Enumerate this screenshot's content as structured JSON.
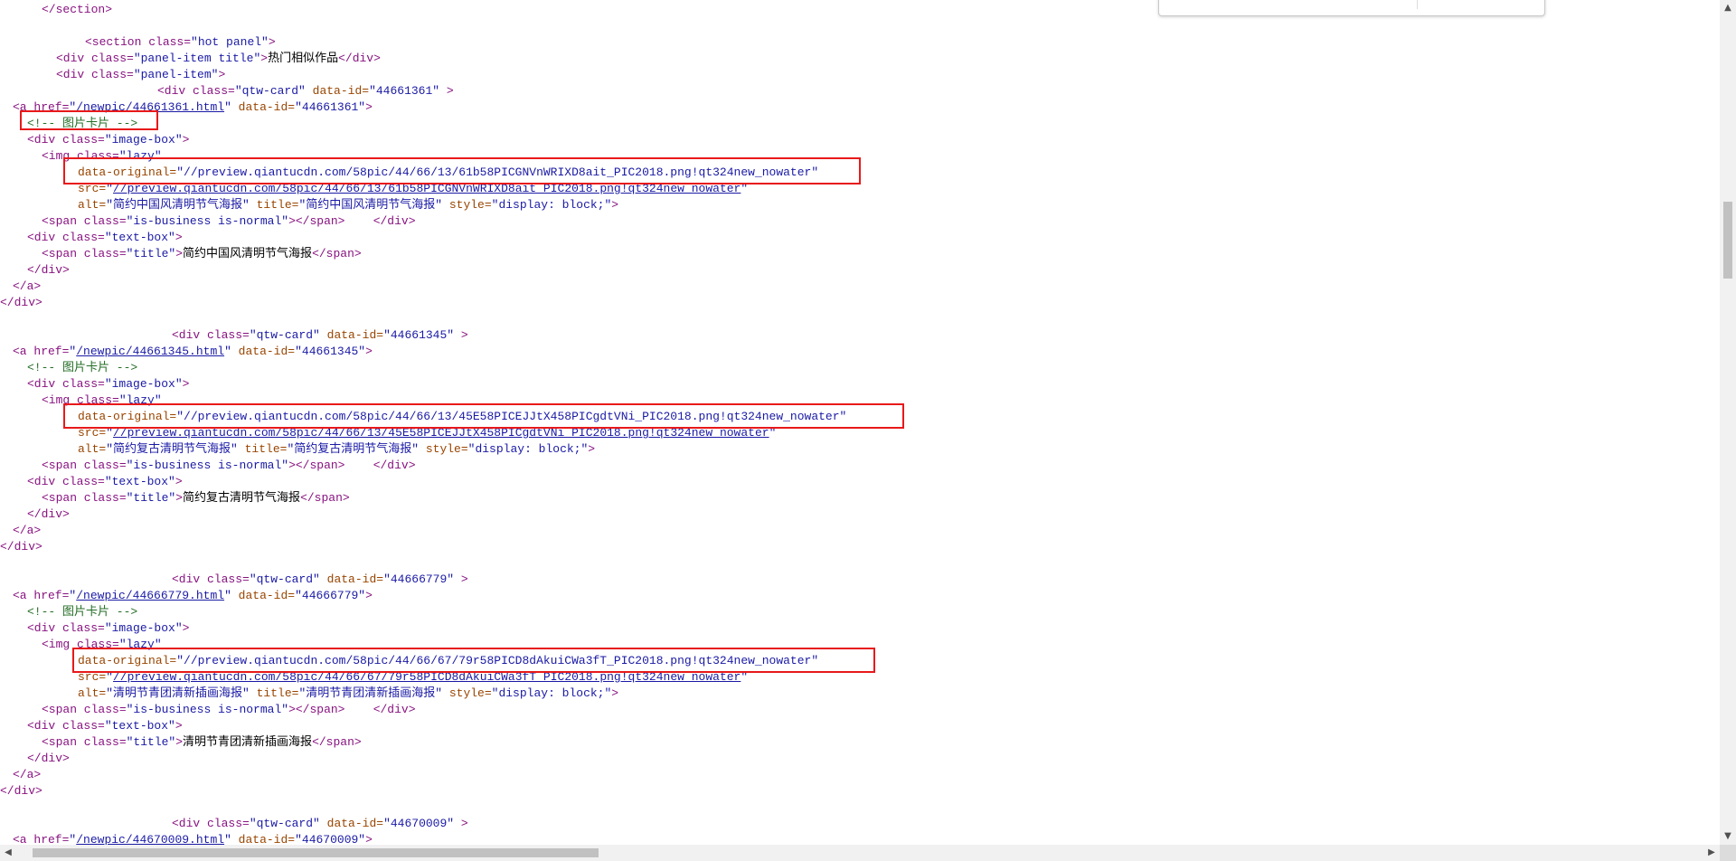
{
  "code": {
    "line01": {
      "close_section": "</section>"
    },
    "line02": {
      "a": "<section class=",
      "b": "\"hot panel\"",
      "c": ">"
    },
    "line03": {
      "a": "<div class=",
      "b": "\"panel-item title\"",
      "c": ">",
      "text": "热门相似作品",
      "d": "</div>"
    },
    "line04": {
      "a": "<div class=",
      "b": "\"panel-item\"",
      "c": ">"
    },
    "cards": [
      {
        "card_open": {
          "a": "<div class=",
          "b": "\"qtw-card\"",
          "c": " data-id=",
          "d": "\"44661361\"",
          "e": " >"
        },
        "a_open": {
          "a": "<a href=",
          "q1": "\"",
          "href": "/newpic/44661361.html",
          "q2": "\"",
          "b": " data-id=",
          "c": "\"44661361\"",
          "d": ">"
        },
        "comment": "<!-- 图片卡片 -->",
        "image_box": {
          "a": "<div class=",
          "b": "\"image-box\"",
          "c": ">"
        },
        "img_open": {
          "a": "<img class=",
          "b": "\"lazy\""
        },
        "data_original": {
          "a": "data-original=",
          "b": "\"//preview.qiantucdn.com/58pic/44/66/13/61b58PICGNVnWRIXD8ait_PIC2018.png!qt324new_nowater\""
        },
        "src": {
          "a": "src=",
          "q1": "\"",
          "url": "//preview.qiantucdn.com/58pic/44/66/13/61b58PICGNVnWRIXD8ait_PIC2018.png!qt324new_nowater",
          "q2": "\""
        },
        "alt": {
          "a": "alt=",
          "b": "\"简约中国风清明节气海报\"",
          "c": " title=",
          "d": "\"简约中国风清明节气海报\"",
          "e": " style=",
          "f": "\"display: block;\"",
          "g": ">"
        },
        "span_business": {
          "a": "<span class=",
          "b": "\"is-business is-normal\"",
          "c": "></span>",
          "d": "    </div>"
        },
        "text_box": {
          "a": "<div class=",
          "b": "\"text-box\"",
          "c": ">"
        },
        "span_title": {
          "a": "<span class=",
          "b": "\"title\"",
          "c": ">",
          "text": "简约中国风清明节气海报",
          "d": "</span>"
        },
        "close_div1": "</div>",
        "close_a": "</a>",
        "close_div2": "</div>"
      },
      {
        "card_open": {
          "a": "<div class=",
          "b": "\"qtw-card\"",
          "c": " data-id=",
          "d": "\"44661345\"",
          "e": " >"
        },
        "a_open": {
          "a": "<a href=",
          "q1": "\"",
          "href": "/newpic/44661345.html",
          "q2": "\"",
          "b": " data-id=",
          "c": "\"44661345\"",
          "d": ">"
        },
        "comment": "<!-- 图片卡片 -->",
        "image_box": {
          "a": "<div class=",
          "b": "\"image-box\"",
          "c": ">"
        },
        "img_open": {
          "a": "<img class=",
          "b": "\"lazy\""
        },
        "data_original": {
          "a": "data-original=",
          "b": "\"//preview.qiantucdn.com/58pic/44/66/13/45E58PICEJJtX458PICgdtVNi_PIC2018.png!qt324new_nowater\""
        },
        "src": {
          "a": "src=",
          "q1": "\"",
          "url": "//preview.qiantucdn.com/58pic/44/66/13/45E58PICEJJtX458PICgdtVNi_PIC2018.png!qt324new_nowater",
          "q2": "\""
        },
        "alt": {
          "a": "alt=",
          "b": "\"简约复古清明节气海报\"",
          "c": " title=",
          "d": "\"简约复古清明节气海报\"",
          "e": " style=",
          "f": "\"display: block;\"",
          "g": ">"
        },
        "span_business": {
          "a": "<span class=",
          "b": "\"is-business is-normal\"",
          "c": "></span>",
          "d": "    </div>"
        },
        "text_box": {
          "a": "<div class=",
          "b": "\"text-box\"",
          "c": ">"
        },
        "span_title": {
          "a": "<span class=",
          "b": "\"title\"",
          "c": ">",
          "text": "简约复古清明节气海报",
          "d": "</span>"
        },
        "close_div1": "</div>",
        "close_a": "</a>",
        "close_div2": "</div>"
      },
      {
        "card_open": {
          "a": "<div class=",
          "b": "\"qtw-card\"",
          "c": " data-id=",
          "d": "\"44666779\"",
          "e": " >"
        },
        "a_open": {
          "a": "<a href=",
          "q1": "\"",
          "href": "/newpic/44666779.html",
          "q2": "\"",
          "b": " data-id=",
          "c": "\"44666779\"",
          "d": ">"
        },
        "comment": "<!-- 图片卡片 -->",
        "image_box": {
          "a": "<div class=",
          "b": "\"image-box\"",
          "c": ">"
        },
        "img_open": {
          "a": "<img class=",
          "b": "\"lazy\""
        },
        "data_original": {
          "a": "data-original=",
          "b": "\"//preview.qiantucdn.com/58pic/44/66/67/79r58PICD8dAkuiCWa3fT_PIC2018.png!qt324new_nowater\""
        },
        "src": {
          "a": "src=",
          "q1": "\"",
          "url": "//preview.qiantucdn.com/58pic/44/66/67/79r58PICD8dAkuiCWa3fT_PIC2018.png!qt324new_nowater",
          "q2": "\""
        },
        "alt": {
          "a": "alt=",
          "b": "\"清明节青团清新插画海报\"",
          "c": " title=",
          "d": "\"清明节青团清新插画海报\"",
          "e": " style=",
          "f": "\"display: block;\"",
          "g": ">"
        },
        "span_business": {
          "a": "<span class=",
          "b": "\"is-business is-normal\"",
          "c": "></span>",
          "d": "    </div>"
        },
        "text_box": {
          "a": "<div class=",
          "b": "\"text-box\"",
          "c": ">"
        },
        "span_title": {
          "a": "<span class=",
          "b": "\"title\"",
          "c": ">",
          "text": "清明节青团清新插画海报",
          "d": "</span>"
        },
        "close_div1": "</div>",
        "close_a": "</a>",
        "close_div2": "</div>"
      }
    ],
    "line_last_card": {
      "a": "<div class=",
      "b": "\"qtw-card\"",
      "c": " data-id=",
      "d": "\"44670009\"",
      "e": " >"
    },
    "line_last_a": {
      "a": "<a href=",
      "q1": "\"",
      "href": "/newpic/44670009.html",
      "q2": "\"",
      "b": " data-id=",
      "c": "\"44670009\"",
      "d": ">"
    }
  },
  "colors": {
    "tag": "#881280",
    "attr_name": "#994500",
    "attr_value": "#1a1aa6",
    "comment": "#236e25",
    "highlight": "#e8191a"
  },
  "icons": {
    "scroll_up": "scroll-up-arrow-icon",
    "scroll_down": "scroll-down-arrow-icon",
    "scroll_left": "scroll-left-arrow-icon",
    "scroll_right": "scroll-right-arrow-icon"
  }
}
